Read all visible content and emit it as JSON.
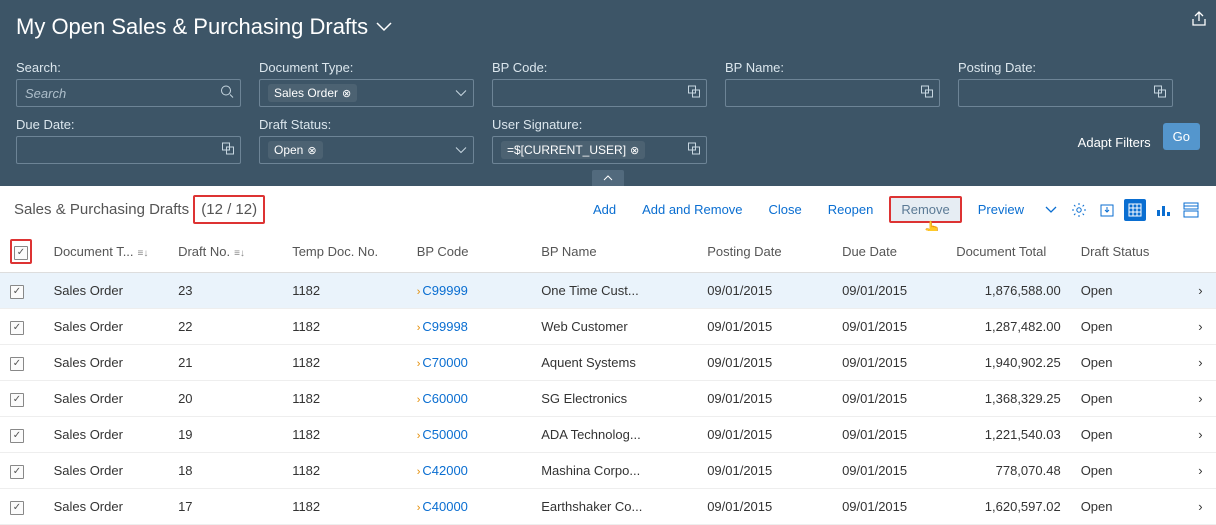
{
  "page_title": "My Open Sales & Purchasing Drafts",
  "filters": {
    "search": {
      "label": "Search:",
      "placeholder": "Search",
      "value": ""
    },
    "doc_type": {
      "label": "Document Type:",
      "token": "Sales Order"
    },
    "bp_code": {
      "label": "BP Code:"
    },
    "bp_name": {
      "label": "BP Name:"
    },
    "posting_date": {
      "label": "Posting Date:"
    },
    "due_date": {
      "label": "Due Date:"
    },
    "draft_status": {
      "label": "Draft Status:",
      "token": "Open"
    },
    "user_sig": {
      "label": "User Signature:",
      "token": "=$[CURRENT_USER]"
    }
  },
  "actions": {
    "adapt": "Adapt Filters",
    "go": "Go"
  },
  "list": {
    "title": "Sales & Purchasing Drafts",
    "count": "(12 / 12)"
  },
  "toolbar": {
    "add": "Add",
    "add_remove": "Add and Remove",
    "close": "Close",
    "reopen": "Reopen",
    "remove": "Remove",
    "preview": "Preview"
  },
  "columns": {
    "doc_type": "Document T...",
    "draft_no": "Draft No.",
    "temp_doc": "Temp Doc. No.",
    "bp_code": "BP Code",
    "bp_name": "BP Name",
    "posting": "Posting Date",
    "due": "Due Date",
    "total": "Document Total",
    "status": "Draft Status"
  },
  "rows": [
    {
      "doc_type": "Sales Order",
      "draft_no": "23",
      "temp": "1182",
      "bp_code": "C99999",
      "bp_name": "One Time Cust...",
      "posting": "09/01/2015",
      "due": "09/01/2015",
      "total": "1,876,588.00",
      "status": "Open",
      "sel": true
    },
    {
      "doc_type": "Sales Order",
      "draft_no": "22",
      "temp": "1182",
      "bp_code": "C99998",
      "bp_name": "Web Customer",
      "posting": "09/01/2015",
      "due": "09/01/2015",
      "total": "1,287,482.00",
      "status": "Open"
    },
    {
      "doc_type": "Sales Order",
      "draft_no": "21",
      "temp": "1182",
      "bp_code": "C70000",
      "bp_name": "Aquent Systems",
      "posting": "09/01/2015",
      "due": "09/01/2015",
      "total": "1,940,902.25",
      "status": "Open"
    },
    {
      "doc_type": "Sales Order",
      "draft_no": "20",
      "temp": "1182",
      "bp_code": "C60000",
      "bp_name": "SG Electronics",
      "posting": "09/01/2015",
      "due": "09/01/2015",
      "total": "1,368,329.25",
      "status": "Open"
    },
    {
      "doc_type": "Sales Order",
      "draft_no": "19",
      "temp": "1182",
      "bp_code": "C50000",
      "bp_name": "ADA Technolog...",
      "posting": "09/01/2015",
      "due": "09/01/2015",
      "total": "1,221,540.03",
      "status": "Open"
    },
    {
      "doc_type": "Sales Order",
      "draft_no": "18",
      "temp": "1182",
      "bp_code": "C42000",
      "bp_name": "Mashina Corpo...",
      "posting": "09/01/2015",
      "due": "09/01/2015",
      "total": "778,070.48",
      "status": "Open"
    },
    {
      "doc_type": "Sales Order",
      "draft_no": "17",
      "temp": "1182",
      "bp_code": "C40000",
      "bp_name": "Earthshaker Co...",
      "posting": "09/01/2015",
      "due": "09/01/2015",
      "total": "1,620,597.02",
      "status": "Open"
    }
  ]
}
